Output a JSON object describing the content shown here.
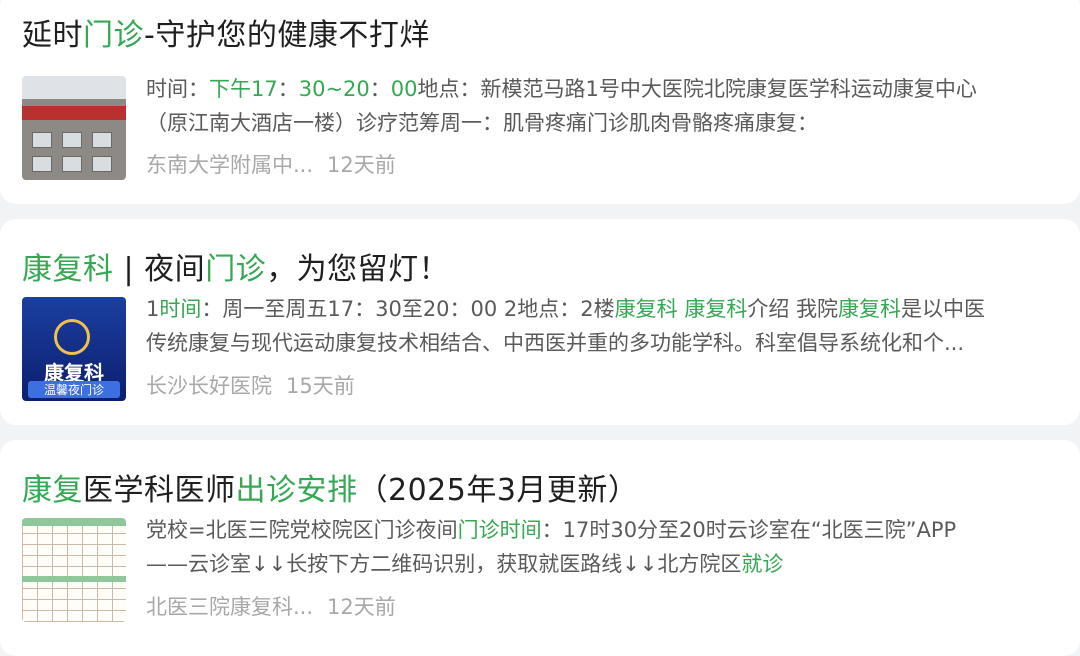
{
  "results": [
    {
      "title_parts": [
        {
          "text": "延时",
          "hl": false
        },
        {
          "text": "门诊",
          "hl": true
        },
        {
          "text": "-守护您的健康不打烊",
          "hl": false
        }
      ],
      "snippet_lines": [
        [
          {
            "text": "时间：",
            "hl": false
          },
          {
            "text": "下午17",
            "hl": true
          },
          {
            "text": "：",
            "hl": false
          },
          {
            "text": "30~20",
            "hl": true
          },
          {
            "text": "：",
            "hl": false
          },
          {
            "text": "00",
            "hl": true
          },
          {
            "text": "地点：新模范马路1号中大医院北院康复医学科运动康复中心",
            "hl": false
          }
        ],
        [
          {
            "text": "（原江南大酒店一楼）诊疗范筹周一：肌骨疼痛门诊肌肉骨骼疼痛康复：",
            "hl": false
          }
        ]
      ],
      "source": "东南大学附属中...",
      "time": "12天前",
      "thumb": "hospital-building-image"
    },
    {
      "title_parts": [
        {
          "text": "康复科",
          "hl": true
        },
        {
          "text": " | 夜间",
          "hl": false
        },
        {
          "text": "门诊",
          "hl": true
        },
        {
          "text": "，为您留灯！",
          "hl": false
        }
      ],
      "snippet_lines": [
        [
          {
            "text": "1",
            "hl": false
          },
          {
            "text": "时间",
            "hl": true
          },
          {
            "text": "：周一至周五17：30至20：00 2地点：2楼",
            "hl": false
          },
          {
            "text": "康复科",
            "hl": true
          },
          {
            "text": " ",
            "hl": false
          },
          {
            "text": "康复科",
            "hl": true
          },
          {
            "text": "介绍 我院",
            "hl": false
          },
          {
            "text": "康复科",
            "hl": true
          },
          {
            "text": "是以中医",
            "hl": false
          }
        ],
        [
          {
            "text": "传统康复与现代运动康复技术相结合、中西医并重的多功能学科。科室倡导系统化和个...",
            "hl": false
          }
        ]
      ],
      "source": "长沙长好医院",
      "time": "15天前",
      "thumb": "night-clinic-poster-image",
      "poster_text": {
        "big": "康复科",
        "sub": "温馨夜门诊"
      }
    },
    {
      "title_parts": [
        {
          "text": "康复",
          "hl": true
        },
        {
          "text": "医学科医师",
          "hl": false
        },
        {
          "text": "出诊安排",
          "hl": true
        },
        {
          "text": "（2025年3月更新）",
          "hl": false
        }
      ],
      "snippet_lines": [
        [
          {
            "text": "党校=北医三院党校院区门诊夜间",
            "hl": false
          },
          {
            "text": "门诊时间",
            "hl": true
          },
          {
            "text": "：17时30分至20时云诊室在“北医三院”APP",
            "hl": false
          }
        ],
        [
          {
            "text": "——云诊室↓↓长按下方二维码识别，获取就医路线↓↓北方院区",
            "hl": false
          },
          {
            "text": "就诊",
            "hl": true
          }
        ]
      ],
      "source": "北医三院康复科...",
      "time": "12天前",
      "thumb": "schedule-table-image"
    }
  ],
  "colors": {
    "highlight": "#34a853",
    "text": "#1f1f1f",
    "snippet": "#5a5a5a",
    "meta": "#a8a8a8",
    "background": "#f2f3f5"
  }
}
